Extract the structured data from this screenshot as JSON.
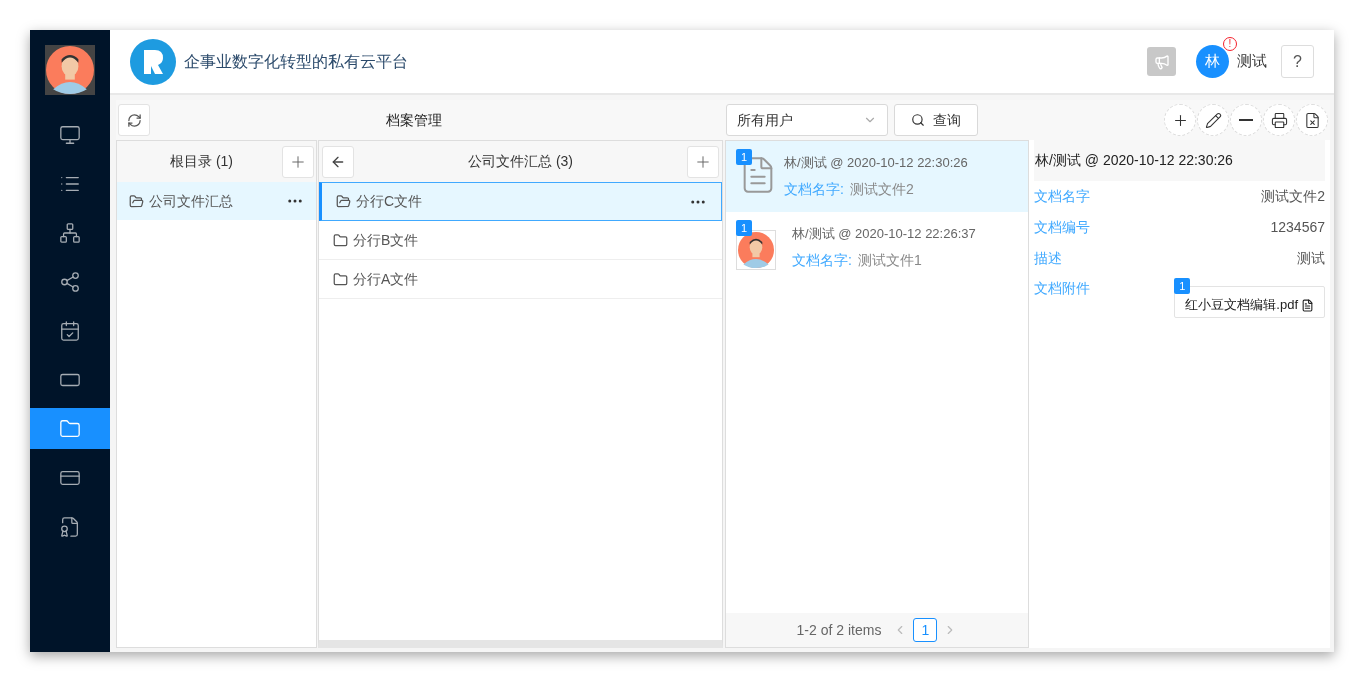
{
  "header": {
    "title": "企事业数字化转型的私有云平台"
  },
  "user": {
    "avatar_text": "林",
    "alert": "!",
    "name": "测试",
    "help": "?"
  },
  "sidebar": {
    "items": [
      {
        "kind": "monitor",
        "selected": false
      },
      {
        "kind": "list",
        "selected": false
      },
      {
        "kind": "network",
        "selected": false
      },
      {
        "kind": "nodes",
        "selected": false
      },
      {
        "kind": "calendar",
        "selected": false
      },
      {
        "kind": "frame",
        "selected": false
      },
      {
        "kind": "folder",
        "selected": true
      },
      {
        "kind": "card",
        "selected": false
      },
      {
        "kind": "certificate",
        "selected": false
      }
    ]
  },
  "toolbar": {
    "title": "档案管理",
    "user_filter": "所有用户",
    "search_button": "查询"
  },
  "root_panel": {
    "title": "根目录 (1)",
    "items": [
      {
        "name": "公司文件汇总",
        "selected": true
      }
    ]
  },
  "folder_panel": {
    "title": "公司文件汇总 (3)",
    "items": [
      {
        "name": "分行C文件",
        "selected": true
      },
      {
        "name": "分行B文件",
        "selected": false
      },
      {
        "name": "分行A文件",
        "selected": false
      }
    ]
  },
  "documents": {
    "items": [
      {
        "kind": "pdf",
        "badge": "1",
        "author_time": "林/测试 @ 2020-10-12 22:30:26",
        "name_label": "文档名字:",
        "name": "测试文件2",
        "selected": true
      },
      {
        "kind": "avatar",
        "badge": "1",
        "author_time": "林/测试 @ 2020-10-12 22:26:37",
        "name_label": "文档名字:",
        "name": "测试文件1",
        "selected": false
      }
    ],
    "pagination": {
      "summary": "1-2 of 2 items",
      "pages": [
        {
          "label": "1",
          "selected": true
        }
      ]
    }
  },
  "detail": {
    "header": "林/测试 @ 2020-10-12 22:30:26",
    "fields": [
      {
        "label": "文档名字",
        "value": "测试文件2"
      },
      {
        "label": "文档编号",
        "value": "1234567"
      },
      {
        "label": "描述",
        "value": "测试"
      }
    ],
    "attachment": {
      "label": "文档附件",
      "badge": "1",
      "file": "红小豆文档编辑.pdf"
    }
  }
}
